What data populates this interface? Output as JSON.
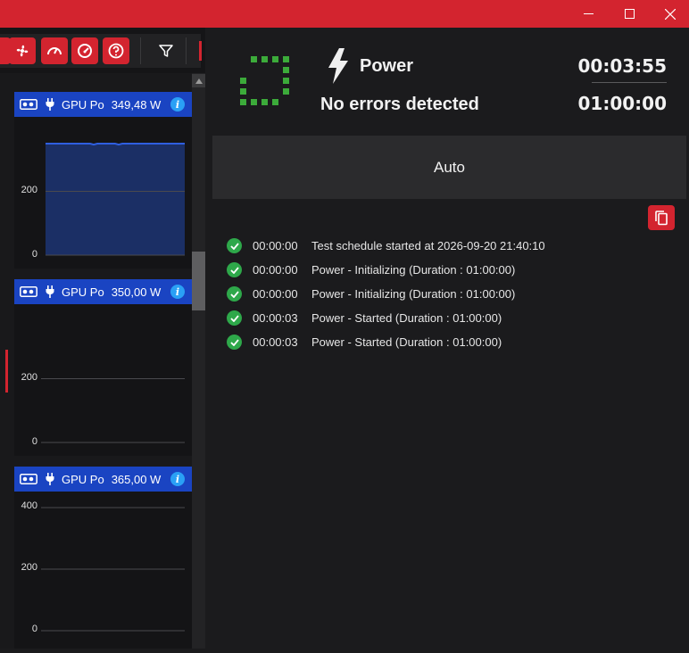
{
  "window": {
    "controls": [
      "minimize-icon",
      "maximize-icon",
      "close-icon"
    ]
  },
  "toolbar": {
    "buttons": [
      "fan-icon",
      "speedometer-icon",
      "gauge-icon",
      "help-icon"
    ],
    "filter_icon": "filter-icon"
  },
  "gpu_panels": [
    {
      "name": "GPU Po",
      "value": "349,48 W",
      "y_ticks": [
        "200",
        "0"
      ],
      "y_max": 400,
      "filled": true,
      "level": 349.48
    },
    {
      "name": "GPU Po",
      "value": "350,00 W",
      "y_ticks": [
        "200",
        "0"
      ],
      "y_max": 400,
      "filled": false
    },
    {
      "name": "GPU Po",
      "value": "365,00 W",
      "y_ticks": [
        "400",
        "200",
        "0"
      ],
      "y_max": 400,
      "filled": false
    }
  ],
  "status": {
    "test_name": "Power",
    "message": "No errors detected",
    "elapsed": "00:03:55",
    "duration": "01:00:00",
    "mode": "Auto",
    "colors": {
      "ok": "#2ea84a",
      "accent": "#d3242f",
      "series_fill": "#1c3473",
      "series_line": "#2f5fe0"
    }
  },
  "log": [
    {
      "time": "00:00:00",
      "text": "Test schedule started at 2026-09-20 21:40:10"
    },
    {
      "time": "00:00:00",
      "text": "Power - Initializing (Duration : 01:00:00)"
    },
    {
      "time": "00:00:00",
      "text": "Power - Initializing (Duration : 01:00:00)"
    },
    {
      "time": "00:00:03",
      "text": "Power - Started (Duration : 01:00:00)"
    },
    {
      "time": "00:00:03",
      "text": "Power - Started (Duration : 01:00:00)"
    }
  ]
}
